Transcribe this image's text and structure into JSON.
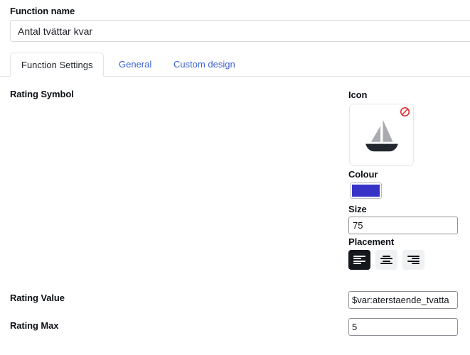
{
  "form": {
    "function_name_label": "Function name",
    "function_name_value": "Antal tvättar kvar"
  },
  "tabs": [
    {
      "label": "Function Settings",
      "active": true
    },
    {
      "label": "General",
      "active": false
    },
    {
      "label": "Custom design",
      "active": false
    }
  ],
  "sections": {
    "rating_symbol_label": "Rating Symbol",
    "rating_value_label": "Rating Value",
    "rating_max_label": "Rating Max"
  },
  "icon_panel": {
    "icon_label": "Icon",
    "icon_name": "sailboat-icon",
    "remove_badge_name": "prohibited-icon",
    "colour_label": "Colour",
    "colour_value": "#3733c6",
    "size_label": "Size",
    "size_value": "75",
    "placement_label": "Placement",
    "placement_options": [
      {
        "name": "align-left-icon",
        "selected": true
      },
      {
        "name": "align-center-icon",
        "selected": false
      },
      {
        "name": "align-right-icon",
        "selected": false
      }
    ]
  },
  "values": {
    "rating_value": "$var:aterstaende_tvatta",
    "rating_max": "5"
  },
  "colors": {
    "link": "#3d62d4",
    "accent_swatch": "#3733c6",
    "badge_red": "#e0262b",
    "sail_gray": "#a9abb0",
    "hull_dark": "#232830"
  }
}
